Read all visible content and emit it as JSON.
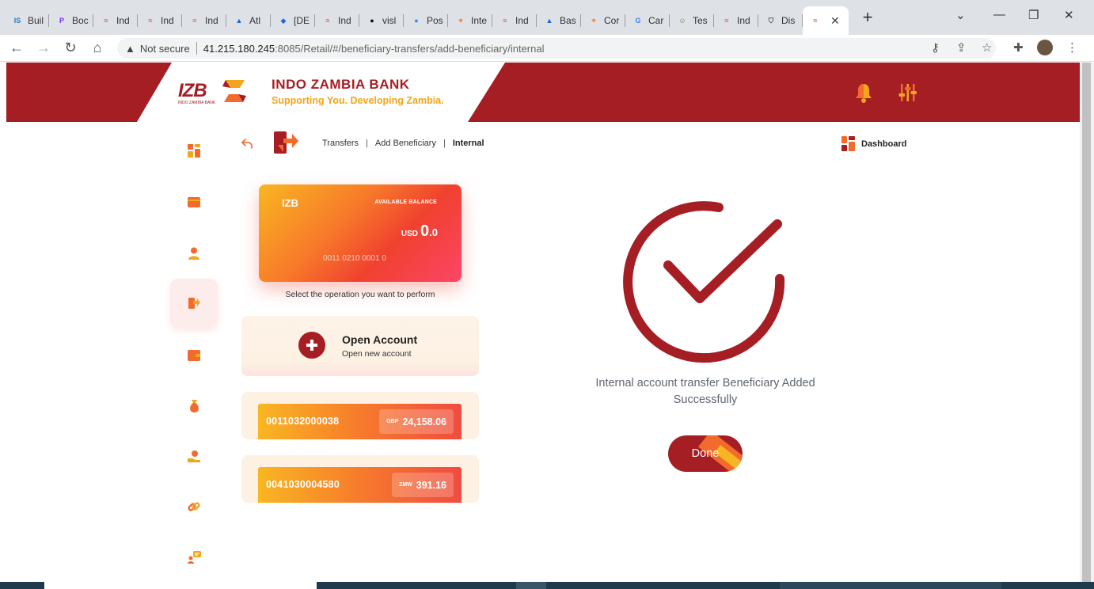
{
  "browser": {
    "tabs": [
      {
        "label": "Buil",
        "fav": "IS",
        "fav_color": "#2a7fb8"
      },
      {
        "label": "Boc",
        "fav": "P",
        "fav_color": "#7b2ff7"
      },
      {
        "label": "Ind",
        "fav": "≈",
        "fav_color": "#e25b3a"
      },
      {
        "label": "Ind",
        "fav": "≈",
        "fav_color": "#e25b3a"
      },
      {
        "label": "Ind",
        "fav": "≈",
        "fav_color": "#e25b3a"
      },
      {
        "label": "Atl",
        "fav": "▲",
        "fav_color": "#1868db"
      },
      {
        "label": "[DE",
        "fav": "◆",
        "fav_color": "#1868db"
      },
      {
        "label": "Ind",
        "fav": "≈",
        "fav_color": "#e25b3a"
      },
      {
        "label": "visl",
        "fav": "●",
        "fav_color": "#111111"
      },
      {
        "label": "Pos",
        "fav": "●",
        "fav_color": "#2d8cff"
      },
      {
        "label": "Inte",
        "fav": "✶",
        "fav_color": "#f26b1d"
      },
      {
        "label": "Ind",
        "fav": "≈",
        "fav_color": "#e25b3a"
      },
      {
        "label": "Bas",
        "fav": "▲",
        "fav_color": "#1868db"
      },
      {
        "label": "Cor",
        "fav": "✶",
        "fav_color": "#f26b1d"
      },
      {
        "label": "Car",
        "fav": "G",
        "fav_color": "#4285f4"
      },
      {
        "label": "Tes",
        "fav": "☺",
        "fav_color": "#8a6b3a"
      },
      {
        "label": "Ind",
        "fav": "≈",
        "fav_color": "#e25b3a"
      },
      {
        "label": "Dis",
        "fav": "⛉",
        "fav_color": "#555555"
      }
    ],
    "active_tab": {
      "fav": "≈",
      "fav_color": "#e25b3a",
      "close": "✕"
    },
    "new_tab": "+",
    "address": {
      "security_label": "Not secure",
      "host": "41.215.180.245",
      "path": ":8085/Retail/#/beneficiary-transfers/add-beneficiary/internal"
    }
  },
  "header": {
    "logo_text": "IZB",
    "logo_sub": "INDO ZAMBIA BANK",
    "bank_name": "INDO ZAMBIA BANK",
    "tagline": "Supporting You. Developing Zambia."
  },
  "breadcrumb": {
    "items": [
      "Transfers",
      "Add Beneficiary",
      "Internal"
    ],
    "separator": "|"
  },
  "dashboard_link": "Dashboard",
  "balance_card": {
    "bank": "IZB",
    "available_label": "AVAILABLE BALANCE",
    "currency": "USD",
    "amount_whole": "0",
    "amount_fraction": ".0",
    "account_number": "0011 0210 0001 0"
  },
  "select_operation_text": "Select the operation you want to perform",
  "open_account": {
    "title": "Open Account",
    "subtitle": "Open new account"
  },
  "accounts": [
    {
      "number": "0011032000038",
      "currency": "GBP",
      "balance": "24,158.06"
    },
    {
      "number": "0041030004580",
      "currency": "ZMW",
      "balance": "391.16"
    }
  ],
  "success": {
    "message": "Internal account transfer Beneficiary Added Successfully",
    "done_label": "Done"
  },
  "colors": {
    "brand_red": "#a51e24",
    "brand_orange": "#f26b2c",
    "brand_yellow": "#f2a51d"
  }
}
